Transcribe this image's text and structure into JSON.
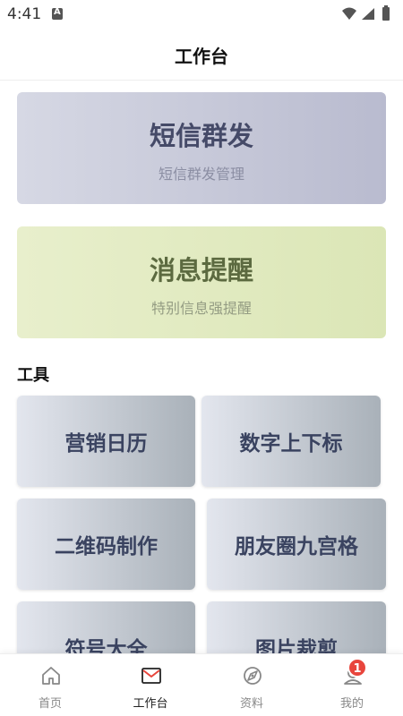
{
  "status_bar": {
    "time": "4:41"
  },
  "header": {
    "title": "工作台"
  },
  "banners": [
    {
      "title": "短信群发",
      "subtitle": "短信群发管理"
    },
    {
      "title": "消息提醒",
      "subtitle": "特别信息强提醒"
    }
  ],
  "tools_section": {
    "title": "工具",
    "items": [
      {
        "label": "营销日历"
      },
      {
        "label": "数字上下标"
      },
      {
        "label": "二维码制作"
      },
      {
        "label": "朋友圈九宫格"
      },
      {
        "label": "符号大全"
      },
      {
        "label": "图片裁剪"
      }
    ]
  },
  "tabbar": {
    "tabs": [
      {
        "label": "首页",
        "icon": "home-icon"
      },
      {
        "label": "工作台",
        "icon": "mail-icon",
        "active": true
      },
      {
        "label": "资料",
        "icon": "compass-icon"
      },
      {
        "label": "我的",
        "icon": "profile-icon",
        "badge": "1"
      }
    ]
  },
  "colors": {
    "accent": "#e8453c",
    "tool_text": "#3a4360"
  }
}
